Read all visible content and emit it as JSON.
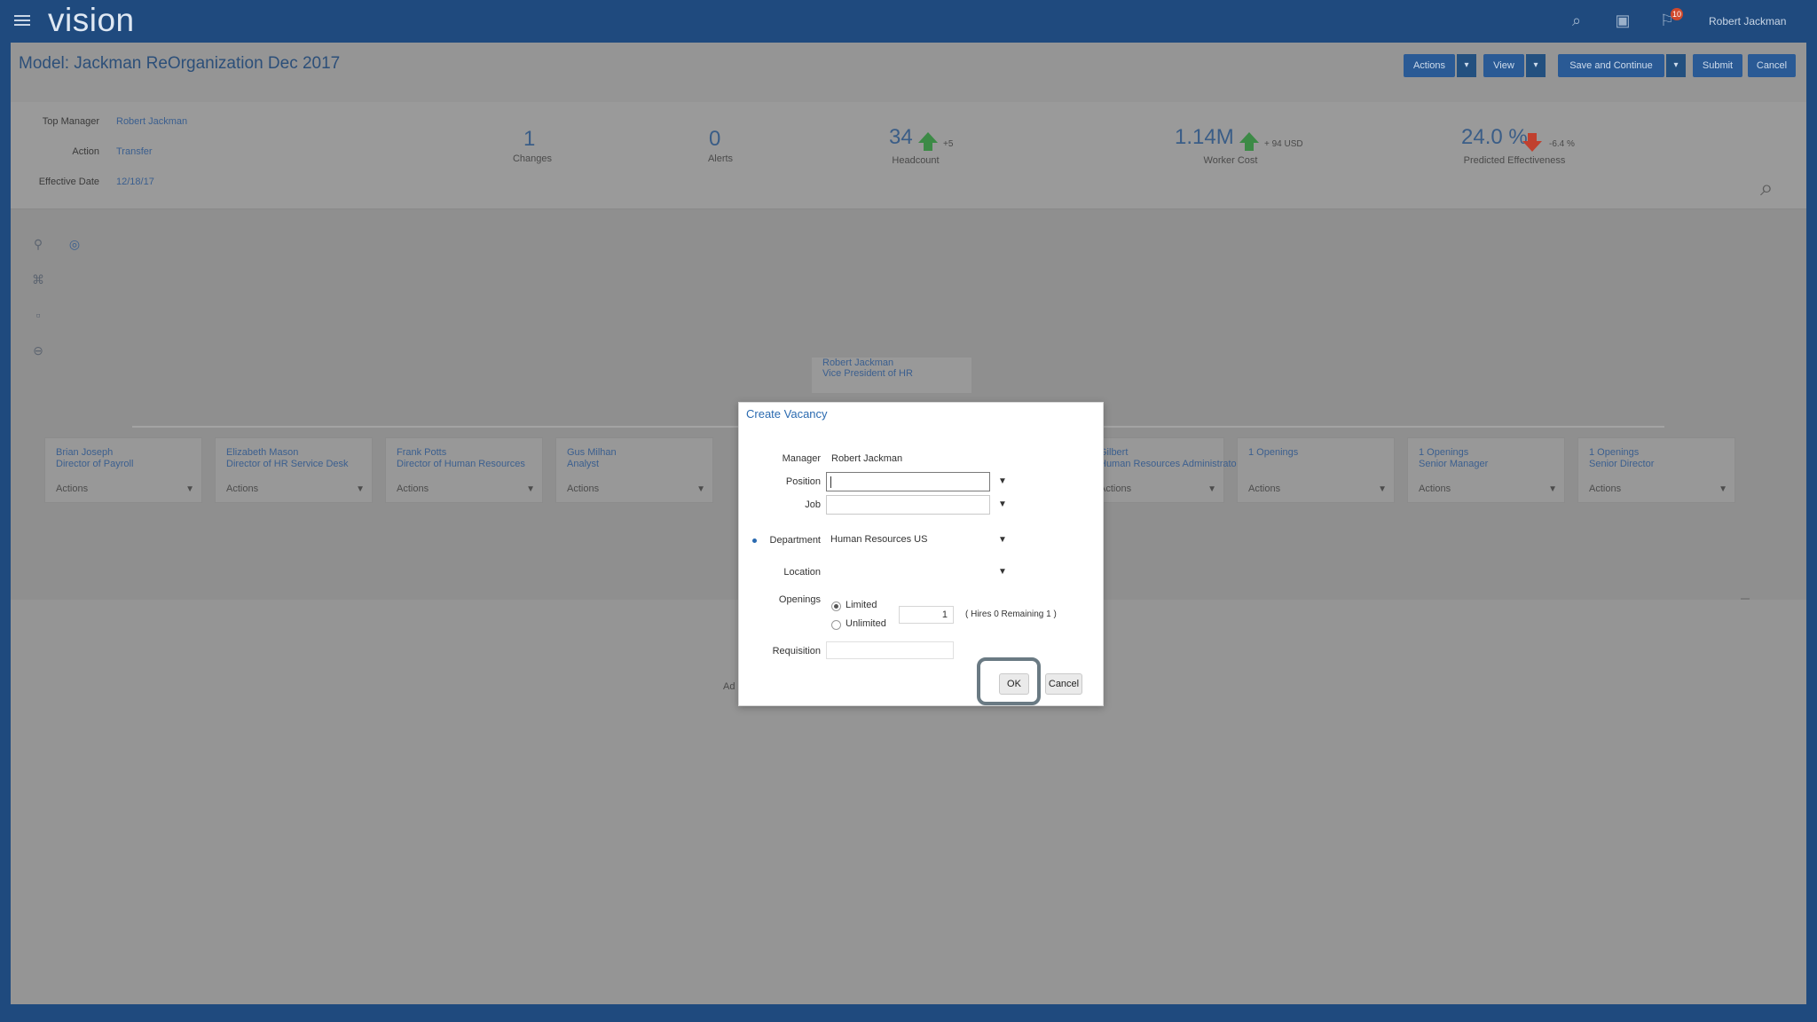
{
  "header": {
    "logo": "vision",
    "user": "Robert Jackman",
    "notification_count": "10",
    "icons": [
      "menu-icon",
      "search-icon",
      "briefcase-icon",
      "notification-icon"
    ]
  },
  "page": {
    "title": "Model: Jackman ReOrganization Dec 2017",
    "buttons": {
      "actions": "Actions",
      "view": "View",
      "save_continue": "Save and Continue",
      "submit": "Submit",
      "cancel": "Cancel",
      "caret": "▾"
    }
  },
  "info": {
    "top_manager_label": "Top Manager",
    "top_manager_value": "Robert Jackman",
    "action_label": "Action",
    "action_value": "Transfer",
    "effective_date_label": "Effective Date",
    "effective_date_value": "12/18/17"
  },
  "metrics": {
    "changes": {
      "value": "1",
      "label": "Changes"
    },
    "alerts": {
      "value": "0",
      "label": "Alerts"
    },
    "headcount": {
      "value": "34",
      "label": "Headcount",
      "delta": "+5"
    },
    "worker_cost": {
      "value": "1.14M",
      "label": "Worker Cost",
      "delta": "+ 94 USD"
    },
    "effectiveness": {
      "value": "24.0 %",
      "label": "Predicted Effectiveness",
      "delta": "-6.4 %"
    }
  },
  "org": {
    "root_name": "Robert Jackman",
    "root_title": "Vice President of HR",
    "cards": [
      {
        "name": "Brian Joseph",
        "title": "Director of Payroll",
        "actions": "Actions"
      },
      {
        "name": "Elizabeth Mason",
        "title": "Director of HR Service Desk",
        "actions": "Actions"
      },
      {
        "name": "Frank Potts",
        "title": "Director of Human Resources",
        "actions": "Actions"
      },
      {
        "name": "Gus Milhan",
        "title": "Analyst",
        "actions": "Actions"
      },
      {
        "name": "Gilbert",
        "title": "Human Resources Administrator",
        "actions": "Actions"
      },
      {
        "name": "1 Openings",
        "title": "",
        "actions": "Actions"
      },
      {
        "name": "1 Openings",
        "title": "Senior Manager",
        "actions": "Actions"
      },
      {
        "name": "1 Openings",
        "title": "Senior Director",
        "actions": "Actions"
      }
    ],
    "behind_text": "Ad"
  },
  "dialog": {
    "title": "Create Vacancy",
    "manager_label": "Manager",
    "manager_value": "Robert Jackman",
    "position_label": "Position",
    "position_value": "",
    "job_label": "Job",
    "department_label": "Department",
    "department_value": "Human Resources US",
    "location_label": "Location",
    "openings_label": "Openings",
    "limited_label": "Limited",
    "unlimited_label": "Unlimited",
    "openings_count": "1",
    "hires_text": "( Hires  0  Remaining  1 )",
    "requisition_label": "Requisition",
    "ok_label": "OK",
    "cancel_label": "Cancel",
    "selected_opening": "Limited"
  }
}
